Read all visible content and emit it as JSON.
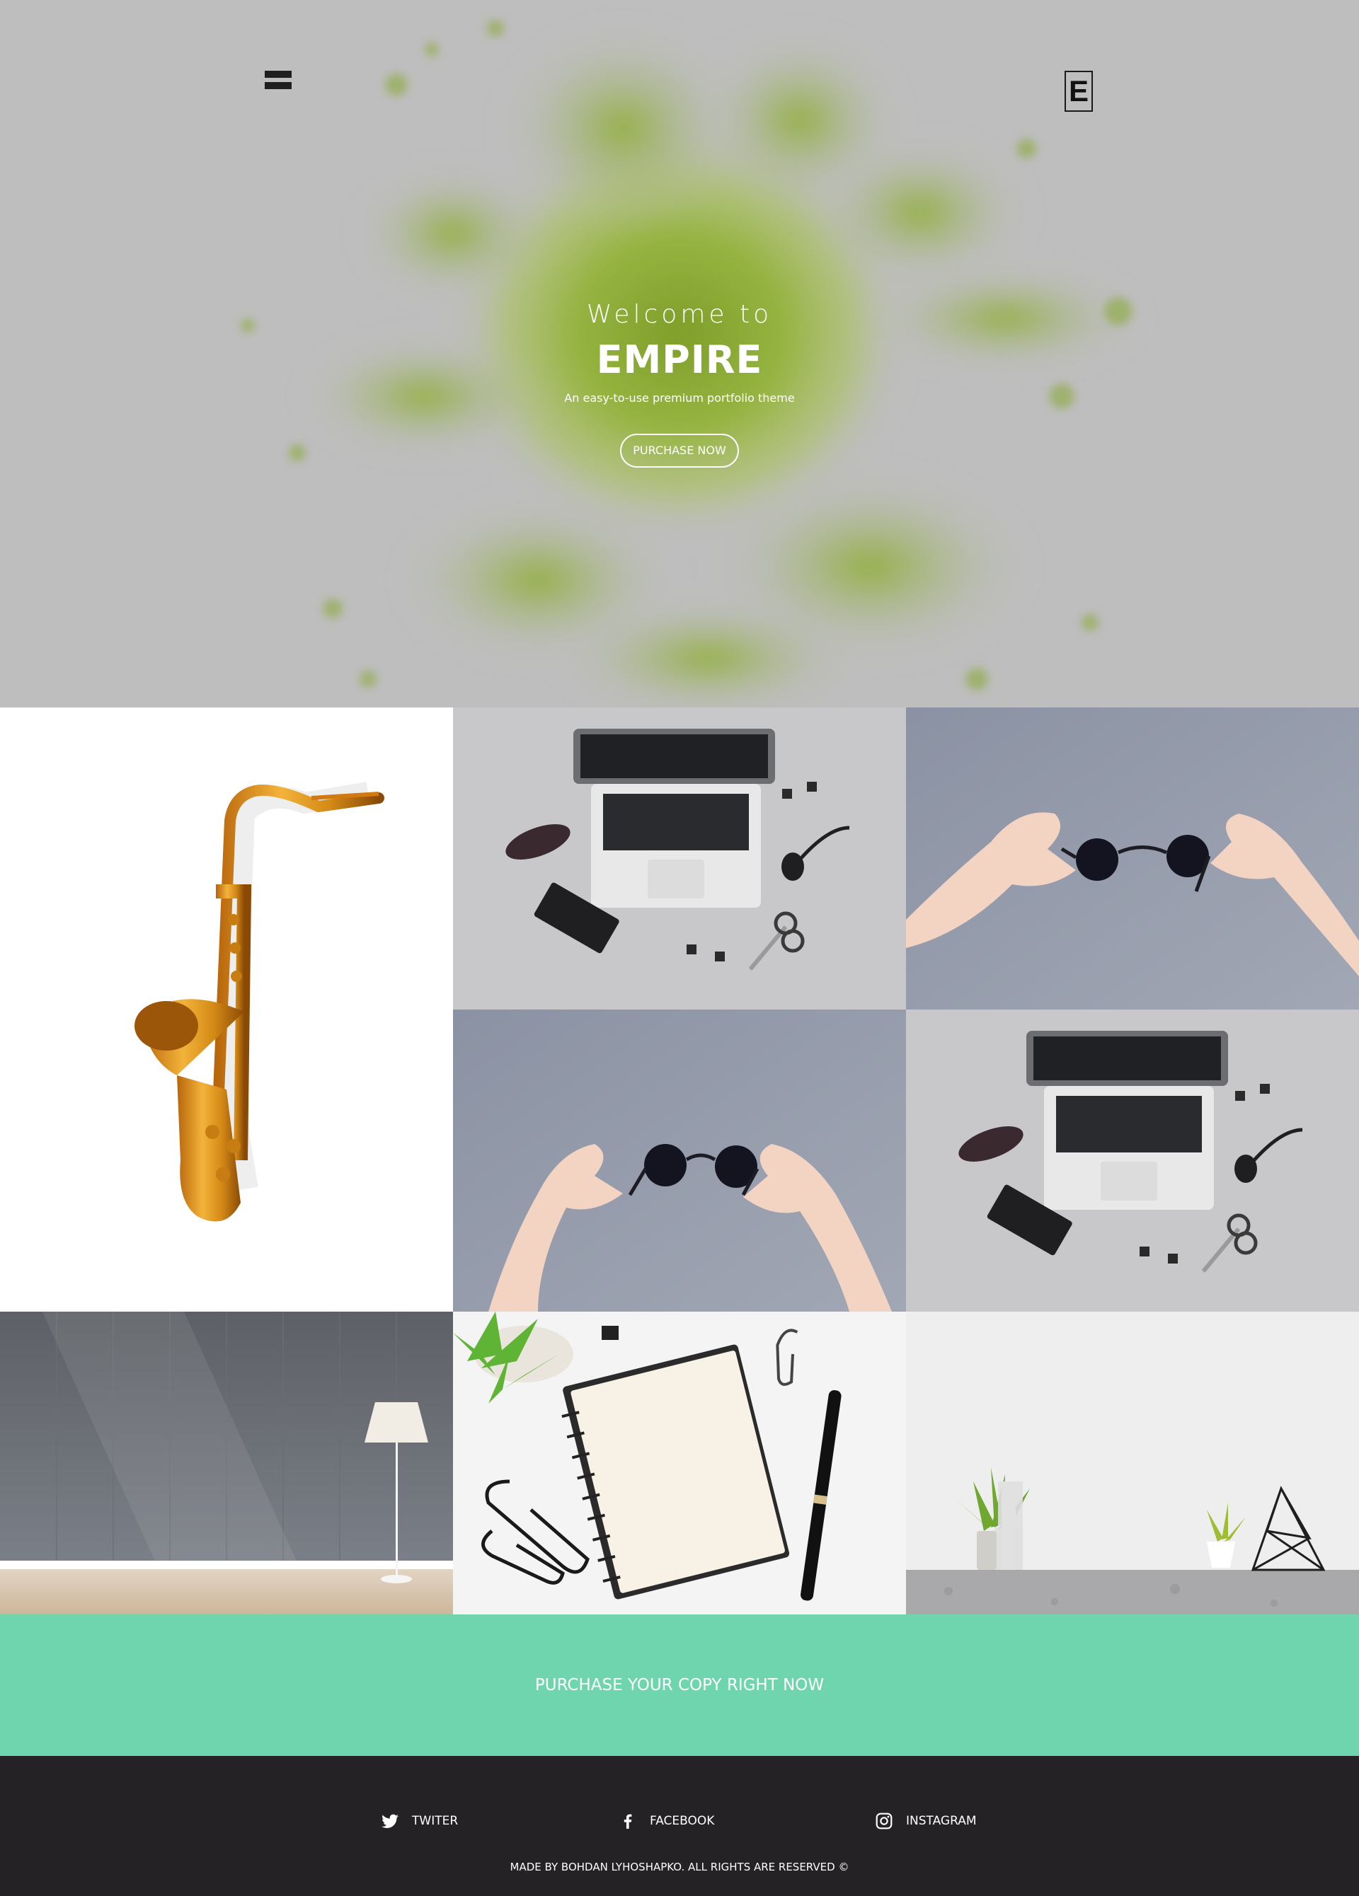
{
  "hero": {
    "welcome": "Welcome to",
    "title": "EMPIRE",
    "subtitle": "An easy-to-use premium portfolio theme",
    "button": "PURCHASE NOW",
    "logo_letter": "E"
  },
  "icons": {
    "menu": "hamburger-menu-icon",
    "twitter": "twitter-icon",
    "facebook": "facebook-icon",
    "instagram": "instagram-icon"
  },
  "gallery": {
    "items": [
      "saxophone",
      "laptop-desk-flatlay",
      "hands-holding-sunglasses",
      "hands-holding-sunglasses",
      "laptop-desk-flatlay",
      "floor-lamp-room",
      "notebook-pen-paperclips",
      "plants-shelf"
    ]
  },
  "cta": {
    "label": "PURCHASE YOUR COPY RIGHT NOW"
  },
  "footer": {
    "social": [
      {
        "label": "TWITER"
      },
      {
        "label": "FACEBOOK"
      },
      {
        "label": "INSTAGRAM"
      }
    ],
    "copyright": "MADE BY BOHDAN LYHOSHAPKO. ALL RIGHTS ARE RESERVED ©"
  },
  "colors": {
    "hero_bg": "#bebebe",
    "powder_green": "#8aab32",
    "cta_bg": "#6fd5ae",
    "footer_bg": "#242224"
  }
}
